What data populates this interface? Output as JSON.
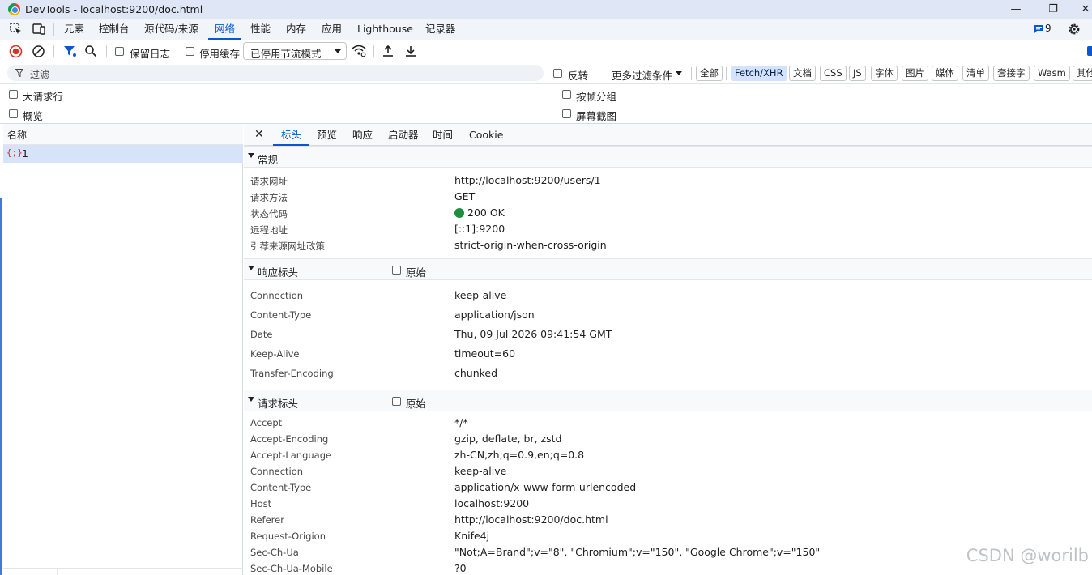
{
  "window": {
    "title": "DevTools - localhost:9200/doc.html",
    "minimize": "—",
    "maximize": "❐",
    "close": "✕"
  },
  "tabs": [
    "元素",
    "控制台",
    "源代码/来源",
    "网络",
    "性能",
    "内存",
    "应用",
    "Lighthouse",
    "记录器"
  ],
  "active_tab": "网络",
  "issues_count": "9",
  "toolbar": {
    "preserve_log": "保留日志",
    "disable_cache": "停用缓存",
    "throttle_value": "已停用节流模式"
  },
  "filter": {
    "placeholder": "过滤",
    "invert": "反转",
    "more_filters": "更多过滤条件",
    "types": [
      "全部",
      "Fetch/XHR",
      "文档",
      "CSS",
      "JS",
      "字体",
      "图片",
      "媒体",
      "清单",
      "套接字",
      "Wasm",
      "其他"
    ],
    "active_type": "Fetch/XHR"
  },
  "options": {
    "big_rows": "大请求行",
    "overview": "概览",
    "group_by_frame": "按帧分组",
    "screenshots": "屏幕截图"
  },
  "request_list": {
    "header": "名称",
    "items": [
      {
        "name": "1",
        "icon": "{;}"
      }
    ]
  },
  "detail": {
    "close": "✕",
    "tabs": [
      "标头",
      "预览",
      "响应",
      "启动器",
      "时间",
      "Cookie"
    ],
    "active_tab": "标头",
    "raw_label": "原始",
    "general": {
      "title": "常规",
      "rows": [
        {
          "name": "请求网址",
          "value": "http://localhost:9200/users/1"
        },
        {
          "name": "请求方法",
          "value": "GET"
        },
        {
          "name": "状态代码",
          "value": "200 OK"
        },
        {
          "name": "远程地址",
          "value": "[::1]:9200"
        },
        {
          "name": "引荐来源网址政策",
          "value": "strict-origin-when-cross-origin"
        }
      ]
    },
    "response_headers": {
      "title": "响应标头",
      "rows": [
        {
          "name": "Connection",
          "value": "keep-alive"
        },
        {
          "name": "Content-Type",
          "value": "application/json"
        },
        {
          "name": "Date",
          "value": "Thu, 09 Jul 2026 09:41:54 GMT"
        },
        {
          "name": "Keep-Alive",
          "value": "timeout=60"
        },
        {
          "name": "Transfer-Encoding",
          "value": "chunked"
        }
      ]
    },
    "request_headers": {
      "title": "请求标头",
      "rows": [
        {
          "name": "Accept",
          "value": "*/*"
        },
        {
          "name": "Accept-Encoding",
          "value": "gzip, deflate, br, zstd"
        },
        {
          "name": "Accept-Language",
          "value": "zh-CN,zh;q=0.9,en;q=0.8"
        },
        {
          "name": "Connection",
          "value": "keep-alive"
        },
        {
          "name": "Content-Type",
          "value": "application/x-www-form-urlencoded"
        },
        {
          "name": "Host",
          "value": "localhost:9200"
        },
        {
          "name": "Referer",
          "value": "http://localhost:9200/doc.html"
        },
        {
          "name": "Request-Origion",
          "value": "Knife4j"
        },
        {
          "name": "Sec-Ch-Ua",
          "value": "\"Not;A=Brand\";v=\"8\", \"Chromium\";v=\"150\", \"Google Chrome\";v=\"150\""
        },
        {
          "name": "Sec-Ch-Ua-Mobile",
          "value": "?0"
        }
      ]
    }
  },
  "colors": {
    "accent": "#0b57d0",
    "status_ok": "#1e8e3e",
    "record_red": "#d93025"
  },
  "watermark": "CSDN @worilb"
}
